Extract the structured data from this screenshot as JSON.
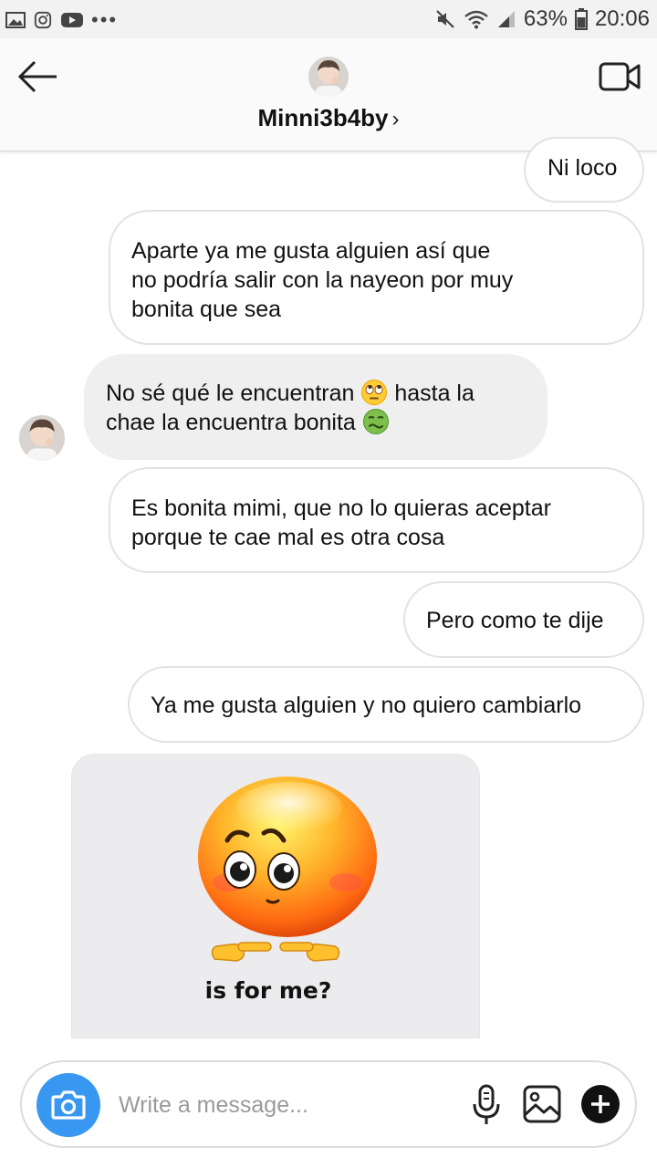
{
  "status_bar": {
    "battery": "63%",
    "time": "20:06",
    "dots": "•••"
  },
  "header": {
    "username": "Minni3b4by",
    "chevron": "›",
    "icons": [
      "back-arrow-icon",
      "video-call-icon"
    ]
  },
  "messages": [
    {
      "side": "outgoing",
      "text": "Ni loco"
    },
    {
      "side": "outgoing",
      "lines": [
        "Aparte ya me gusta alguien así que",
        "no podría salir con la nayeon por muy",
        "bonita que sea"
      ]
    },
    {
      "side": "incoming",
      "line1_a": "No sé qué le encuentran",
      "line1_b": "hasta la",
      "line2": "chae la encuentra bonita",
      "emojis": [
        "eye-roll-emoji",
        "nauseated-emoji"
      ]
    },
    {
      "side": "outgoing",
      "lines": [
        "Es bonita mimi, que no lo quieras aceptar",
        "porque te cae mal es otra cosa"
      ]
    },
    {
      "side": "outgoing",
      "text": "Pero como te dije"
    },
    {
      "side": "outgoing",
      "text": "Ya me gusta alguien y no quiero cambiarlo"
    },
    {
      "side": "incoming",
      "type": "image",
      "caption": "is for me?"
    }
  ],
  "composer": {
    "placeholder": "Write a message...",
    "icons": [
      "camera-icon",
      "microphone-icon",
      "gallery-icon",
      "plus-icon"
    ]
  },
  "colors": {
    "accent": "#3897f0",
    "incoming_bubble": "#efefef",
    "outgoing_border": "#e2e2e2"
  }
}
